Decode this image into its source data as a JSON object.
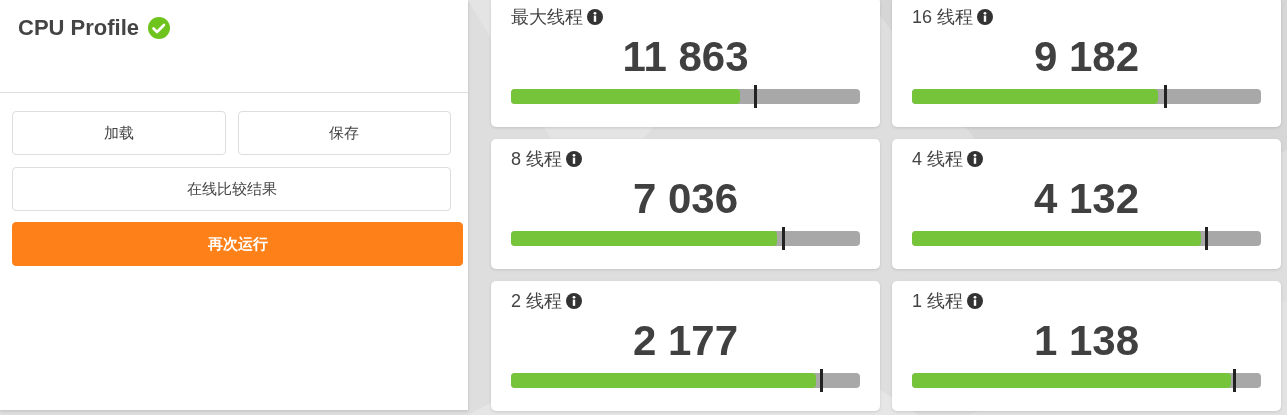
{
  "panel": {
    "title": "CPU Profile",
    "verified": true,
    "buttons": [
      {
        "label": "加载",
        "kind": "plain"
      },
      {
        "label": "保存",
        "kind": "plain"
      },
      {
        "label": "在线比较结果",
        "kind": "wide"
      },
      {
        "label": "再次运行",
        "kind": "primary"
      }
    ]
  },
  "scores": [
    {
      "label": "最大线程",
      "value": "11 863",
      "level": 0.655,
      "reference": {
        "level": 0.699
      }
    },
    {
      "label": "16 线程",
      "value": "9 182",
      "level": 0.704,
      "reference": {
        "level": 0.724
      }
    },
    {
      "label": "8 线程",
      "value": "7 036",
      "level": 0.761,
      "reference": {
        "level": 0.778
      }
    },
    {
      "label": "4 线程",
      "value": "4 132",
      "level": 0.828,
      "reference": {
        "level": 0.842
      }
    },
    {
      "label": "2 线程",
      "value": "2 177",
      "level": 0.873,
      "reference": {
        "level": 0.888
      }
    },
    {
      "label": "1 线程",
      "value": "1 138",
      "level": 0.914,
      "reference": {
        "level": 0.922
      }
    }
  ]
}
